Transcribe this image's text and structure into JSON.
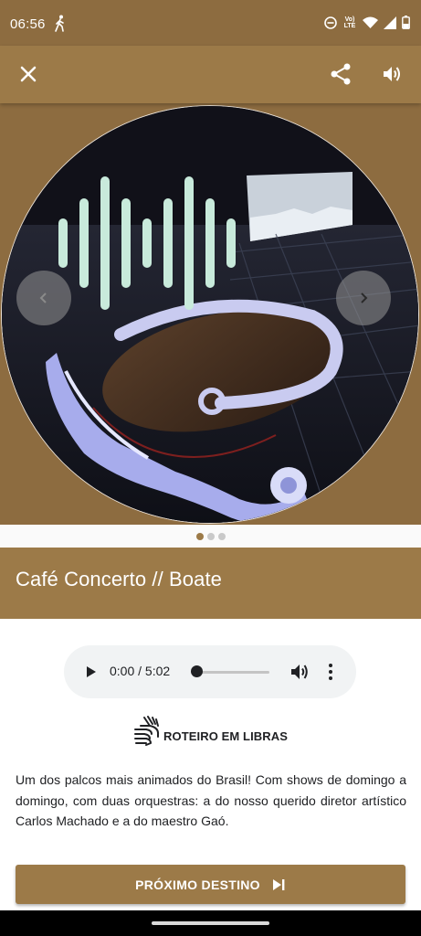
{
  "status": {
    "time": "06:56",
    "network_label": "Vo) LTE",
    "icons": [
      "walk-icon",
      "dnd-icon",
      "wifi-icon",
      "signal-icon",
      "battery-icon"
    ]
  },
  "toolbar": {
    "icons": [
      "close-icon",
      "share-icon",
      "volume-icon"
    ]
  },
  "hero": {
    "carousel_page": 1,
    "carousel_pages": 3,
    "icons": [
      "sound-wave-icon",
      "chevron-left-icon",
      "chevron-right-icon"
    ]
  },
  "place": {
    "title": "Café Concerto // Boate"
  },
  "audio": {
    "time": "0:00 / 5:02",
    "progress": 0.0
  },
  "libras": {
    "label": "ROTEIRO EM LIBRAS",
    "icon": "sign-language-icon"
  },
  "description": "Um dos palcos mais animados do Brasil! Com shows de domingo a domingo, com duas orquestras: a do nosso querido diretor artístico Carlos Machado e a do maestro Gaó.",
  "next_button": {
    "label": "PRÓXIMO DESTINO",
    "icon": "skip-next-icon"
  },
  "colors": {
    "brown": "#9c7a48",
    "brown_dark": "#8d6c40",
    "wave": "#c8eadb"
  }
}
